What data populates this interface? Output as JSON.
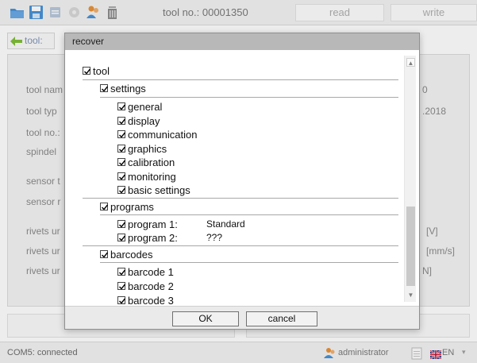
{
  "toolbar": {
    "title": "tool no.: 00001350",
    "read_label": "read",
    "write_label": "write",
    "icons": [
      "folder-open-icon",
      "save-icon",
      "print-icon",
      "gear-icon",
      "user-icon",
      "delete-icon"
    ]
  },
  "nav": {
    "back_label": "tool:"
  },
  "background_form": {
    "labels": [
      "tool nam",
      "tool typ",
      "tool no.:",
      "spindel",
      "sensor t",
      "sensor r",
      "rivets ur",
      "rivets ur",
      "rivets ur"
    ],
    "right_values": [
      "0",
      ".2018",
      "[V]",
      "[mm/s]",
      "N]"
    ]
  },
  "dialog": {
    "title": "recover",
    "tree": {
      "root": {
        "label": "tool",
        "checked": true
      },
      "settings": {
        "label": "settings",
        "checked": true,
        "items": [
          {
            "label": "general",
            "checked": true
          },
          {
            "label": "display",
            "checked": true
          },
          {
            "label": "communication",
            "checked": true
          },
          {
            "label": "graphics",
            "checked": true
          },
          {
            "label": "calibration",
            "checked": true
          },
          {
            "label": "monitoring",
            "checked": true
          },
          {
            "label": "basic settings",
            "checked": true
          }
        ]
      },
      "programs": {
        "label": "programs",
        "checked": true,
        "items": [
          {
            "label": "program 1:",
            "value": "Standard",
            "checked": true
          },
          {
            "label": "program 2:",
            "value": "???",
            "checked": true
          }
        ]
      },
      "barcodes": {
        "label": "barcodes",
        "checked": true,
        "items": [
          {
            "label": "barcode 1",
            "checked": true
          },
          {
            "label": "barcode 2",
            "checked": true
          },
          {
            "label": "barcode 3",
            "checked": true
          }
        ]
      }
    },
    "ok_label": "OK",
    "cancel_label": "cancel"
  },
  "statusbar": {
    "connection": "COM5: connected",
    "user": "administrator",
    "language": "EN"
  },
  "colors": {
    "dialog_title_bg": "#b8b8b8",
    "toolbar_icon_blue": "#4a93d8",
    "user_icon_orange": "#e8923a"
  }
}
